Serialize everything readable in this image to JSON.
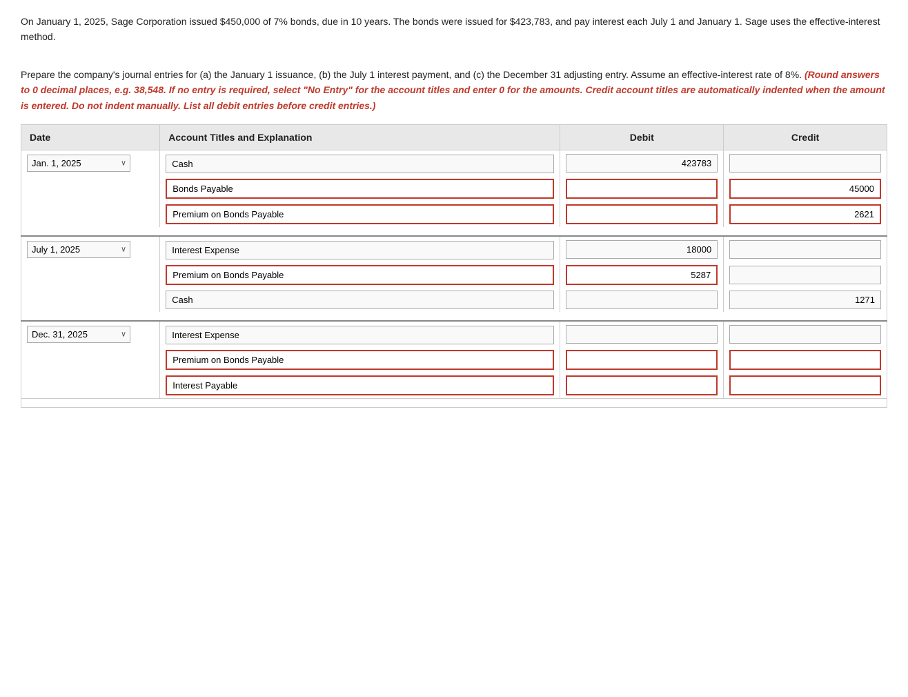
{
  "intro": {
    "paragraph1": "On January 1, 2025, Sage Corporation issued $450,000 of 7% bonds, due in 10 years. The bonds were issued for $423,783, and pay interest each July 1 and January 1. Sage uses the effective-interest method.",
    "paragraph2": "Prepare the company's journal entries for (a) the January 1 issuance, (b) the July 1 interest payment, and (c) the December 31 adjusting entry. Assume an effective-interest rate of 8%.",
    "instructions": "(Round answers to 0 decimal places, e.g. 38,548. If no entry is required, select \"No Entry\" for the account titles and enter 0 for the amounts. Credit account titles are automatically indented when the amount is entered. Do not indent manually. List all debit entries before credit entries.)"
  },
  "table": {
    "headers": {
      "date": "Date",
      "account": "Account Titles and Explanation",
      "debit": "Debit",
      "credit": "Credit"
    }
  },
  "entries": [
    {
      "date_value": "Jan. 1, 2025",
      "date_options": [
        "Jan. 1, 2025",
        "July 1, 2025",
        "Dec. 31, 2025"
      ],
      "rows": [
        {
          "account": "Cash",
          "account_red": false,
          "debit": "423783",
          "credit": "",
          "debit_red": false,
          "credit_red": false
        },
        {
          "account": "Bonds Payable",
          "account_red": true,
          "debit": "",
          "credit": "45000",
          "debit_red": true,
          "credit_red": true
        },
        {
          "account": "Premium on Bonds Payable",
          "account_red": true,
          "debit": "",
          "credit": "2621",
          "debit_red": true,
          "credit_red": true
        }
      ]
    },
    {
      "date_value": "July 1, 2025",
      "date_options": [
        "Jan. 1, 2025",
        "July 1, 2025",
        "Dec. 31, 2025"
      ],
      "rows": [
        {
          "account": "Interest Expense",
          "account_red": false,
          "debit": "18000",
          "credit": "",
          "debit_red": false,
          "credit_red": false
        },
        {
          "account": "Premium on Bonds Payable",
          "account_red": true,
          "debit": "5287",
          "credit": "",
          "debit_red": true,
          "credit_red": false
        },
        {
          "account": "Cash",
          "account_red": false,
          "debit": "",
          "credit": "1271",
          "debit_red": false,
          "credit_red": false
        }
      ]
    },
    {
      "date_value": "Dec. 31, 2025",
      "date_options": [
        "Jan. 1, 2025",
        "July 1, 2025",
        "Dec. 31, 2025"
      ],
      "rows": [
        {
          "account": "Interest Expense",
          "account_red": false,
          "debit": "",
          "credit": "",
          "debit_red": false,
          "credit_red": false
        },
        {
          "account": "Premium on Bonds Payable",
          "account_red": true,
          "debit": "",
          "credit": "",
          "debit_red": true,
          "credit_red": true
        },
        {
          "account": "Interest Payable",
          "account_red": true,
          "debit": "",
          "credit": "",
          "debit_red": true,
          "credit_red": true
        }
      ]
    }
  ]
}
